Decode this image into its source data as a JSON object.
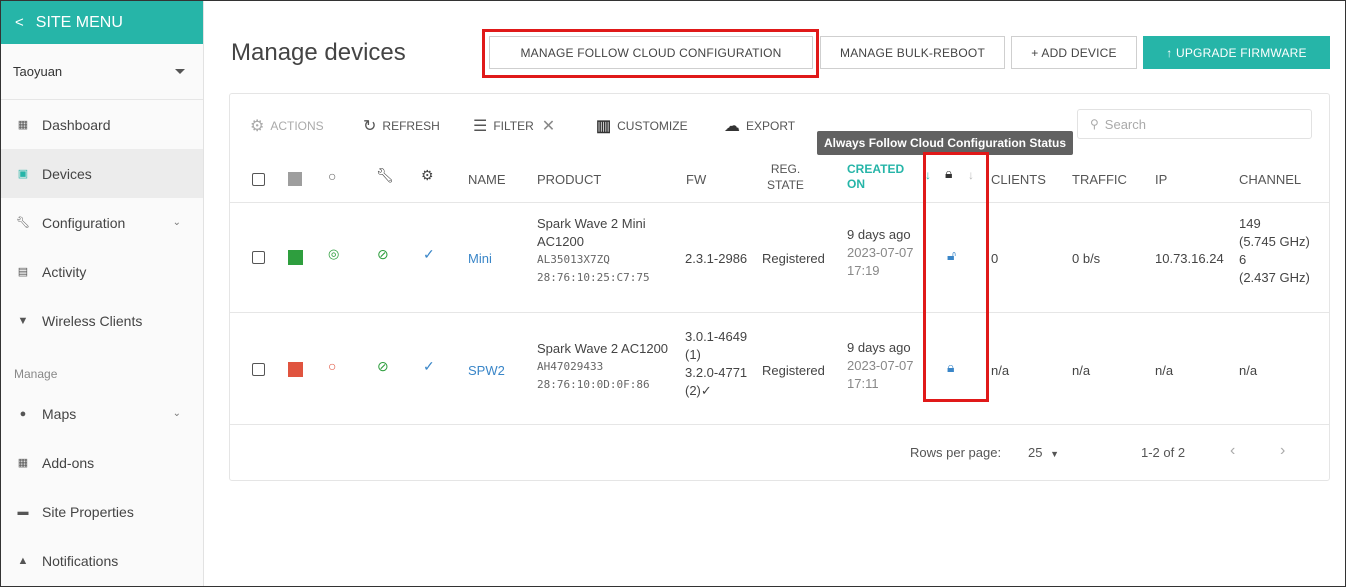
{
  "sidebar": {
    "header": "SITE MENU",
    "site": "Taoyuan",
    "items": [
      {
        "label": "Dashboard"
      },
      {
        "label": "Devices"
      },
      {
        "label": "Configuration"
      },
      {
        "label": "Activity"
      },
      {
        "label": "Wireless Clients"
      }
    ],
    "section_manage": "Manage",
    "manage_items": [
      {
        "label": "Maps"
      },
      {
        "label": "Add-ons"
      },
      {
        "label": "Site Properties"
      },
      {
        "label": "Notifications"
      }
    ]
  },
  "header": {
    "title": "Manage devices",
    "buttons": {
      "follow_cloud": "MANAGE FOLLOW CLOUD CONFIGURATION",
      "bulk_reboot": "MANAGE BULK-REBOOT",
      "add_device": "+ ADD DEVICE",
      "upgrade_firmware": "↑ UPGRADE FIRMWARE"
    }
  },
  "toolbar": {
    "actions": "ACTIONS",
    "refresh": "REFRESH",
    "filter": "FILTER",
    "customize": "CUSTOMIZE",
    "export": "EXPORT",
    "search_placeholder": "Search"
  },
  "tooltip": "Always Follow Cloud Configuration Status",
  "table": {
    "columns": {
      "name": "NAME",
      "product": "PRODUCT",
      "fw": "FW",
      "reg_state_1": "REG.",
      "reg_state_2": "STATE",
      "created_1": "CREATED",
      "created_2": "ON",
      "clients": "CLIENTS",
      "traffic": "TRAFFIC",
      "ip": "IP",
      "channel": "CHANNEL"
    },
    "rows": [
      {
        "name": "Mini",
        "product_1": "Spark Wave 2 Mini",
        "product_2": "AC1200",
        "serial": "AL35013X7ZQ",
        "mac": "28:76:10:25:C7:75",
        "fw": "2.3.1-2986",
        "reg_state": "Registered",
        "created_ago": "9 days ago",
        "created_date": "2023-07-07",
        "created_time": "17:19",
        "clients": "0",
        "traffic": "0 b/s",
        "ip": "10.73.16.24",
        "channel_1": "149",
        "channel_2": "(5.745 GHz)",
        "channel_3": "6",
        "channel_4": "(2.437 GHz)",
        "status_color": "#2e9e3e",
        "cloud_lock": "unlocked"
      },
      {
        "name": "SPW2",
        "product_1": "Spark Wave 2 AC1200",
        "serial": "AH47029433",
        "mac": "28:76:10:0D:0F:86",
        "fw_1": "3.0.1-4649",
        "fw_2": "(1)",
        "fw_3": "3.2.0-4771",
        "fw_4": "(2)✓",
        "reg_state": "Registered",
        "created_ago": "9 days ago",
        "created_date": "2023-07-07",
        "created_time": "17:11",
        "clients": "n/a",
        "traffic": "n/a",
        "ip": "n/a",
        "channel": "n/a",
        "status_color": "#e0543f",
        "cloud_lock": "locked"
      }
    ]
  },
  "pagination": {
    "rows_per_page_label": "Rows per page:",
    "rows_per_page": "25",
    "range": "1-2 of 2"
  },
  "colors": {
    "accent": "#26b5a8",
    "highlight_box": "#e01919",
    "link": "#3a86c8"
  }
}
